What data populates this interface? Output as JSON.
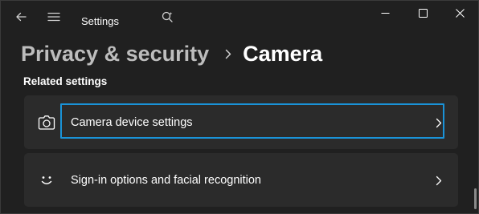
{
  "window": {
    "app_title": "Settings",
    "controls": {
      "minimize": "minimize-icon",
      "maximize": "maximize-icon",
      "close": "close-icon"
    }
  },
  "toolbar": {
    "back": "back-arrow-icon",
    "menu": "hamburger-menu-icon",
    "search": "search-icon"
  },
  "breadcrumb": {
    "parent": "Privacy & security",
    "separator": "chevron-right-icon",
    "current": "Camera"
  },
  "section": {
    "title": "Related settings"
  },
  "settings": [
    {
      "label": "Camera device settings",
      "icon": "camera-icon",
      "focused": true
    },
    {
      "label": "Sign-in options and facial recognition",
      "icon": "smiley-face-icon",
      "focused": false
    }
  ],
  "colors": {
    "background": "#202020",
    "card": "#2b2b2b",
    "focus": "#1a93d8",
    "breadcrumb_parent": "#bdbdbd"
  }
}
